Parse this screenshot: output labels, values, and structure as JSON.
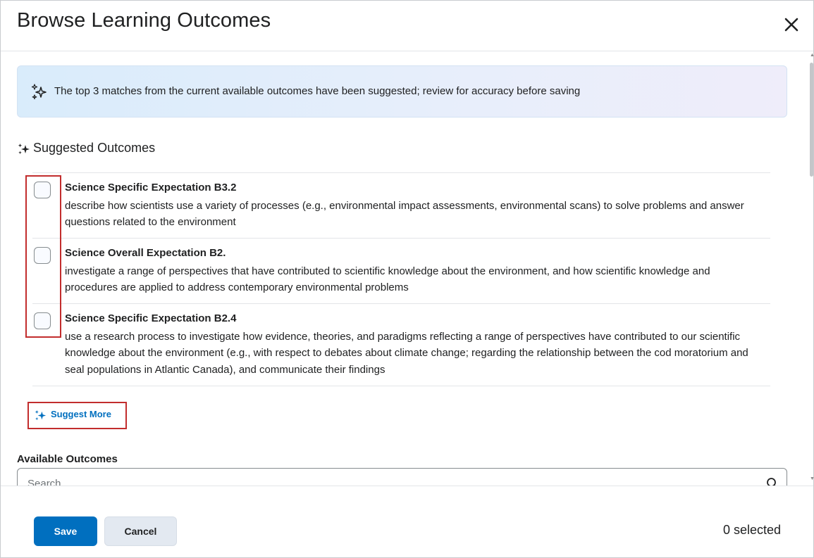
{
  "dialog": {
    "title": "Browse Learning Outcomes",
    "close_icon": "close-icon"
  },
  "banner": {
    "icon": "sparkle-outline-icon",
    "text": "The top 3 matches from the current available outcomes have been suggested; review for accuracy before saving"
  },
  "suggested": {
    "icon": "sparkle-icon",
    "heading": "Suggested Outcomes",
    "items": [
      {
        "name": "Science Specific Expectation B3.2",
        "description": "describe how scientists use a variety of processes (e.g., environmental impact assessments, environmental scans) to solve problems and answer questions related to the environment",
        "checked": false
      },
      {
        "name": "Science Overall Expectation B2.",
        "description": "investigate a range of perspectives that have contributed to scientific knowledge about the environment, and how scientific knowledge and procedures are applied to address contemporary environmental problems",
        "checked": false
      },
      {
        "name": "Science Specific Expectation B2.4",
        "description": "use a research process to investigate how evidence, theories, and paradigms reflecting a range of perspectives have contributed to our scientific knowledge about the environment (e.g., with respect to debates about climate change; regarding the relationship between the cod moratorium and seal populations in Atlantic Canada), and communicate their findings",
        "checked": false
      }
    ],
    "suggest_more_label": "Suggest More"
  },
  "available": {
    "label": "Available Outcomes",
    "search_placeholder": "Search...",
    "search_value": ""
  },
  "footer": {
    "save_label": "Save",
    "cancel_label": "Cancel",
    "selected_text": "0 selected"
  },
  "colors": {
    "primary": "#006fbf",
    "highlight": "#c22d2d",
    "text": "#202122"
  }
}
